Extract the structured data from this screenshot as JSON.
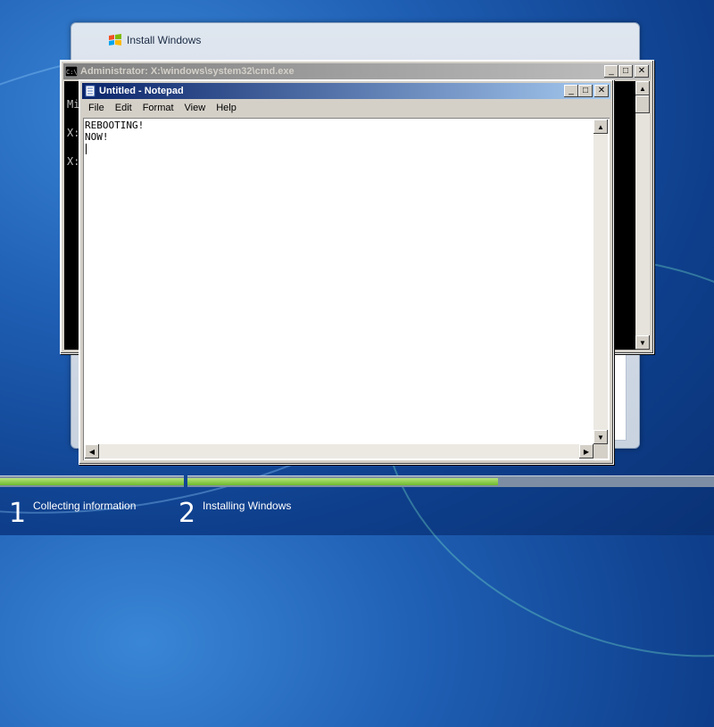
{
  "setup": {
    "title": "Install Windows"
  },
  "cmd": {
    "title": "Administrator: X:\\windows\\system32\\cmd.exe",
    "icon_label": "C:\\",
    "lines": [
      "Mi",
      "",
      "X:",
      "",
      "X:"
    ]
  },
  "notepad": {
    "title": "Untitled - Notepad",
    "menu": [
      "File",
      "Edit",
      "Format",
      "View",
      "Help"
    ],
    "content": "REBOOTING!\nNOW!"
  },
  "window_buttons": {
    "minimize": "_",
    "maximize": "□",
    "close": "✕"
  },
  "progress": {
    "step1_fraction": 1.0,
    "step2_fraction": 0.59
  },
  "steps": [
    {
      "number": "1",
      "label": "Collecting information"
    },
    {
      "number": "2",
      "label": "Installing Windows"
    }
  ],
  "colors": {
    "desktop": "#1f5fb4",
    "progress_fill": "#6dbb2e",
    "active_title": "#0a246a",
    "inactive_title": "#808080"
  }
}
